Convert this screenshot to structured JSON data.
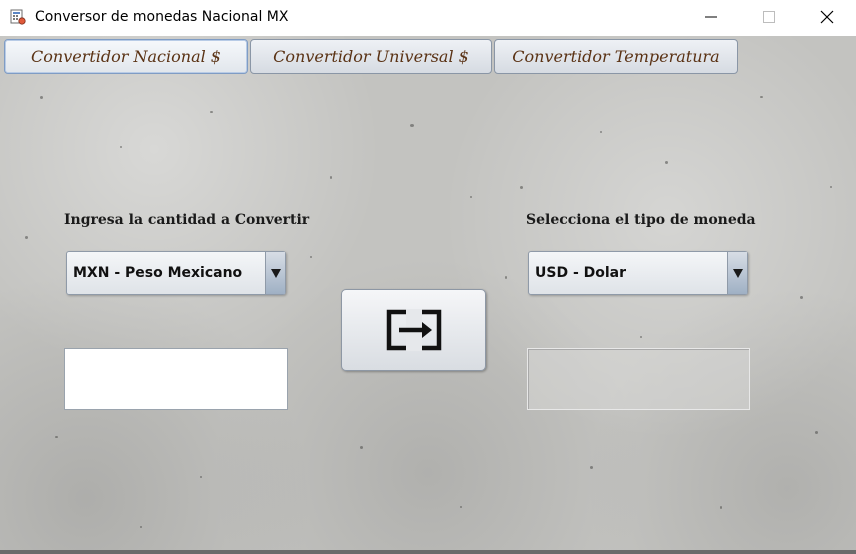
{
  "window": {
    "title": "Conversor de monedas Nacional MX"
  },
  "tabs": [
    {
      "label": "Convertidor Nacional $",
      "selected": true
    },
    {
      "label": "Convertidor Universal $",
      "selected": false
    },
    {
      "label": "Convertidor Temperatura",
      "selected": false
    }
  ],
  "left": {
    "label": "Ingresa la cantidad a Convertir",
    "currency_selected": "MXN - Peso Mexicano",
    "amount_value": ""
  },
  "right": {
    "label": "Selecciona el tipo de moneda",
    "currency_selected": "USD - Dolar",
    "result_value": ""
  },
  "icons": {
    "convert": "exchange-arrow-icon",
    "app": "app-icon",
    "minimize": "minimize-icon",
    "maximize": "maximize-icon",
    "close": "close-icon",
    "dropdown": "chevron-down-icon"
  },
  "colors": {
    "tab_text": "#5a3214",
    "background": "#c3c3c0"
  }
}
